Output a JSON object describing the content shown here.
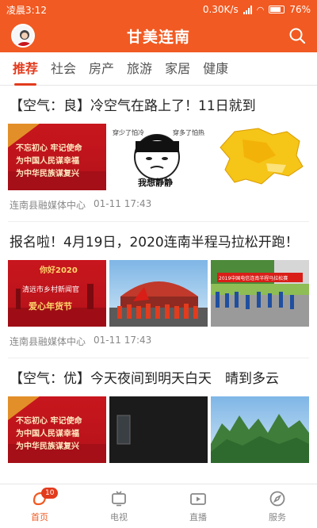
{
  "status": {
    "time": "凌晨3:12",
    "speed": "0.30K/s",
    "battery": "76%"
  },
  "app": {
    "title": "甘美连南"
  },
  "tabs": [
    "推荐",
    "社会",
    "房产",
    "旅游",
    "家居",
    "健康"
  ],
  "articles": [
    {
      "title": "【空气：良】冷空气在路上了！11日就到",
      "source": "连南县融媒体中心",
      "time": "01-11 17:43"
    },
    {
      "title": "报名啦！4月19日，2020连南半程马拉松开跑！",
      "source": "连南县融媒体中心",
      "time": "01-11 17:43"
    },
    {
      "title": "【空气：优】今天夜间到明天白天　晴到多云"
    }
  ],
  "thumb_text": {
    "poster_line1": "不忘初心 牢记使命",
    "poster_line2": "为中国人民谋幸福",
    "poster_line3": "为中华民族谋复兴",
    "meme_caption": "我想静静",
    "meme_tag1": "穿少了怕冷",
    "meme_tag2": "穿多了怕热",
    "fair_title": "你好2020",
    "fair_sub": "清远市乡村新闻官",
    "fair_label": "爱心年货节",
    "race_banner": "2019中国电信连南半程马拉松赛"
  },
  "nav": [
    {
      "label": "首页",
      "badge": "10"
    },
    {
      "label": "电视"
    },
    {
      "label": "直播"
    },
    {
      "label": "服务"
    }
  ],
  "colors": {
    "brand": "#f15a22",
    "accent": "#e23b1d"
  }
}
